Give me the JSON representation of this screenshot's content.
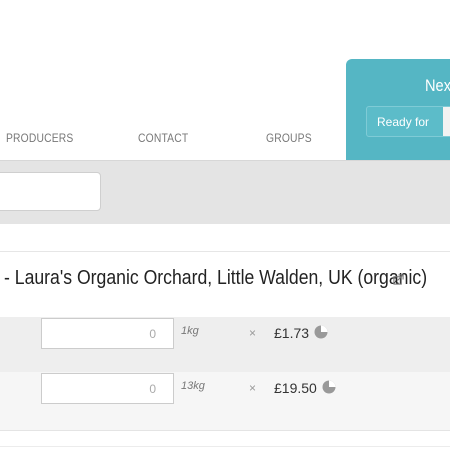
{
  "nav": {
    "links": [
      {
        "label": "PRODUCERS"
      },
      {
        "label": "CONTACT"
      },
      {
        "label": "GROUPS"
      }
    ]
  },
  "cart": {
    "title": "Nex",
    "status": "Ready for"
  },
  "search": {
    "value": "",
    "placeholder": ""
  },
  "product": {
    "title": "- Laura's Organic Orchard, Little Walden, UK (organic)"
  },
  "variants": [
    {
      "quantity": "0",
      "unit": "1kg",
      "times": "×",
      "price": "£1.73"
    },
    {
      "quantity": "0",
      "unit": "13kg",
      "times": "×",
      "price": "£19.50"
    }
  ],
  "colors": {
    "cart_accent": "#55b6c4",
    "filter_bg": "#e4e4e4",
    "row_alt": "#eeeeee"
  },
  "icons": [
    "external-link-icon",
    "pie-chart-icon"
  ]
}
